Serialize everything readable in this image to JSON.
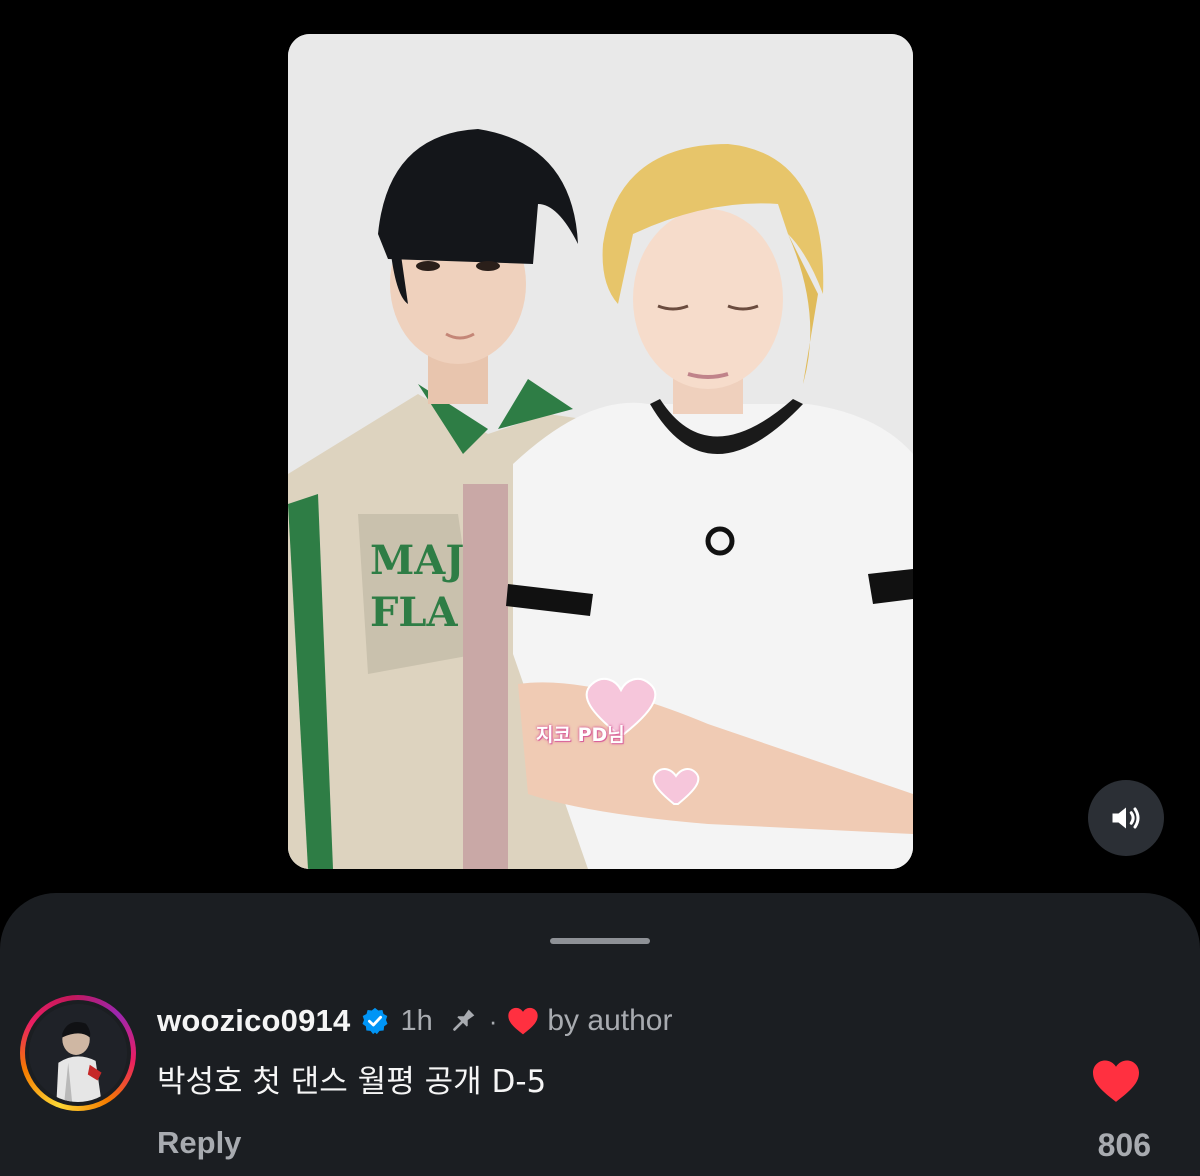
{
  "video": {
    "sticker_text": "지코 PD님"
  },
  "controls": {
    "mute_icon": "speaker-volume-icon"
  },
  "comment": {
    "username": "woozico0914",
    "verified_icon": "verified-badge-icon",
    "time": "1h",
    "pin_icon": "pin-icon",
    "separator": "·",
    "liked_by_author_icon": "heart-icon",
    "liked_by_author_text": "by author",
    "text": "박성호 첫 댄스 월평 공개 D-5",
    "reply_label": "Reply",
    "like_icon": "heart-filled-icon",
    "like_count": "806"
  },
  "colors": {
    "background": "#000000",
    "sheet": "#1b1e22",
    "heart_red": "#ff3040",
    "verified_blue": "#0095f6",
    "muted_text": "#a8abb0"
  }
}
